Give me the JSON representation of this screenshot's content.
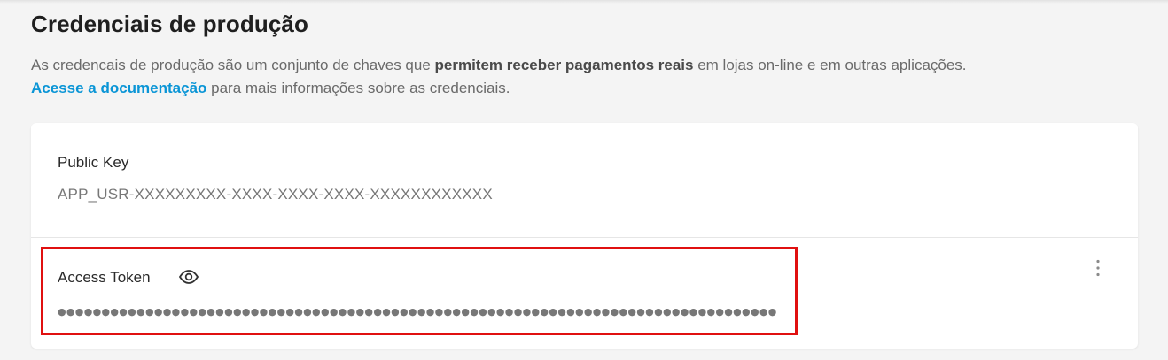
{
  "header": {
    "title": "Credenciais de produção"
  },
  "description": {
    "line1_prefix": "As credencais de produção são um conjunto de chaves que ",
    "line1_bold": "permitem receber pagamentos reais",
    "line1_suffix": " em lojas on-line e em outras aplicações.",
    "link_text": "Acesse a documentação",
    "line2_suffix": " para mais informações sobre as credenciais."
  },
  "credentials": {
    "public_key": {
      "label": "Public Key",
      "value": "APP_USR-XXXXXXXXX-XXXX-XXXX-XXXX-XXXXXXXXXXXX"
    },
    "access_token": {
      "label": "Access Token",
      "masked_value": "●●●●●●●●●●●●●●●●●●●●●●●●●●●●●●●●●●●●●●●●●●●●●●●●●●●●●●●●●●●●●●●●●●●●●●●●●●●●●●●●●●●●●●●●●●●●●●●●●●●",
      "reveal_icon": "eye-icon",
      "menu_icon": "more-vertical-icon"
    }
  },
  "colors": {
    "link": "#0a95d6",
    "highlight": "#e01010",
    "background": "#f4f4f4"
  }
}
